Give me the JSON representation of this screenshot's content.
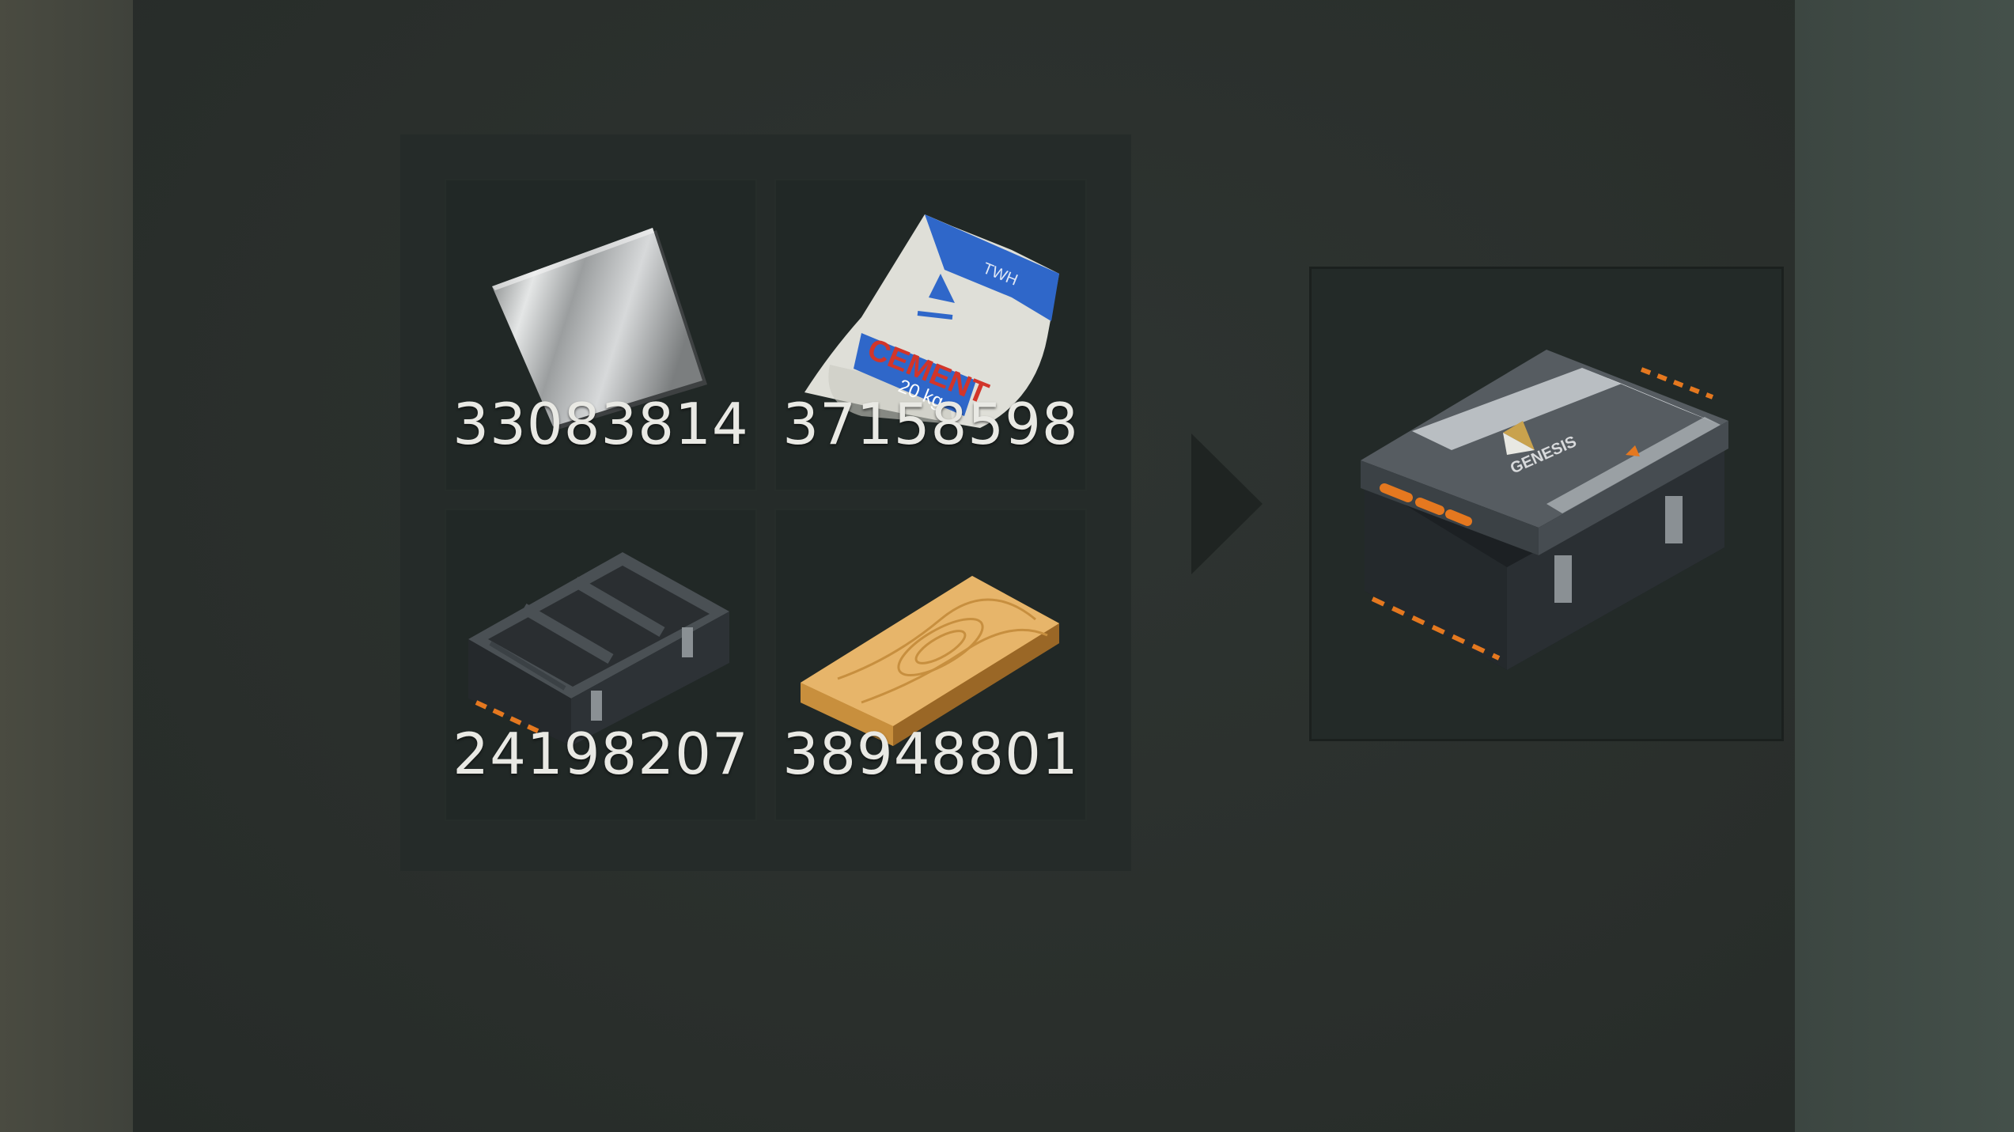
{
  "recipe": {
    "ingredients": [
      {
        "icon": "metal-sheet-icon",
        "count": "33083814"
      },
      {
        "icon": "cement-bag-icon",
        "count": "37158598"
      },
      {
        "icon": "empty-crate-icon",
        "count": "24198207"
      },
      {
        "icon": "wood-plank-icon",
        "count": "38948801"
      }
    ],
    "result": {
      "icon": "genesis-supply-crate-icon",
      "label": "GENESIS"
    }
  },
  "cement_bag": {
    "brand": "TWH",
    "text": "CEMENT",
    "weight": "20 kg"
  },
  "colors": {
    "panel": "#2a2f2c",
    "slot": "#212826",
    "count_text": "#e9e9e4",
    "crate_orange": "#e5781f",
    "bag_blue": "#2f67c9",
    "bag_red": "#d2352a"
  }
}
